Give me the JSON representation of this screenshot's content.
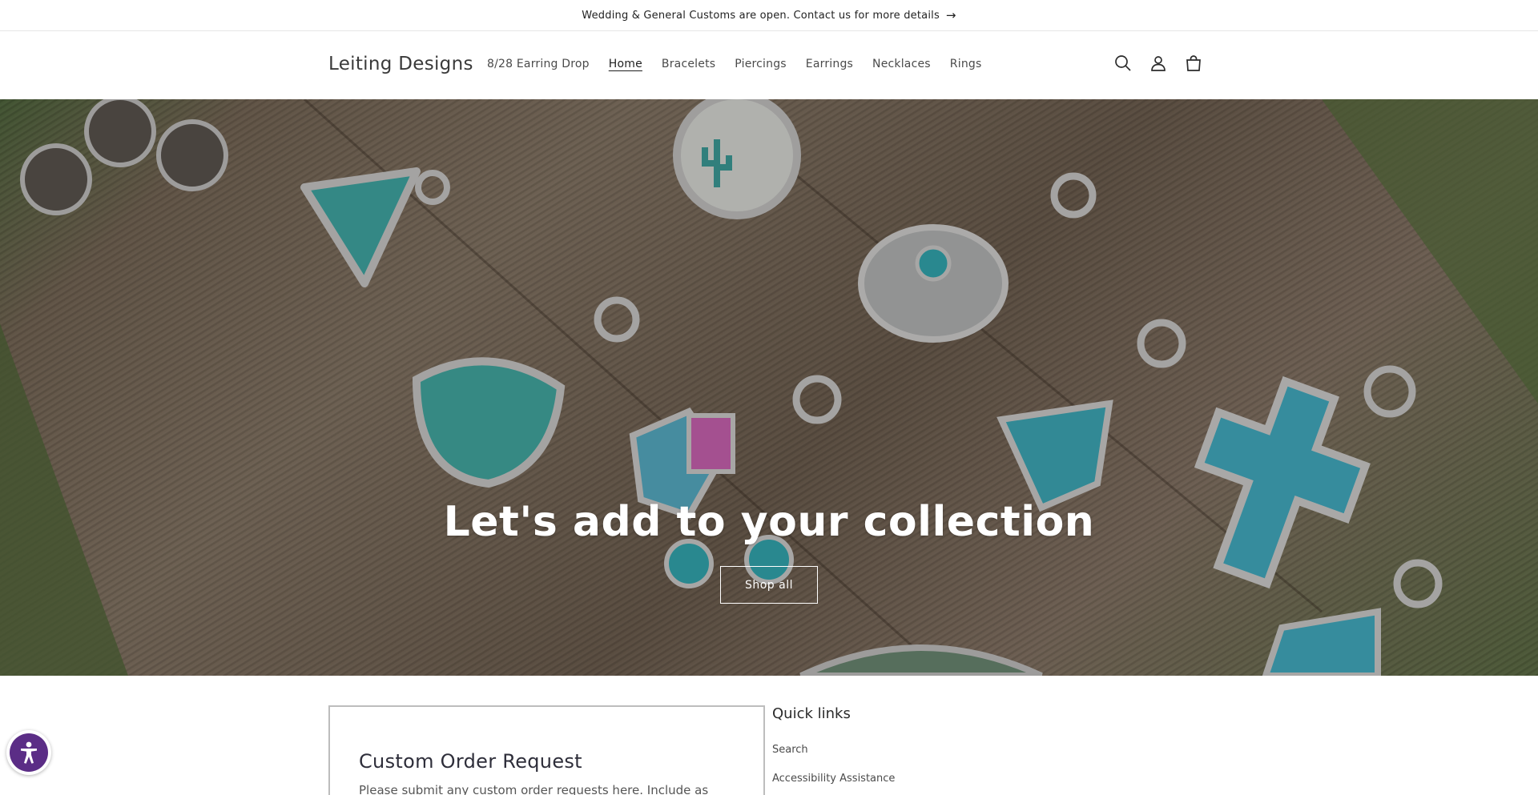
{
  "announcement": {
    "text": "Wedding & General Customs are open. Contact us for more details",
    "arrow": "→"
  },
  "header": {
    "logo": "Leiting Designs",
    "nav": [
      {
        "label": "8/28 Earring Drop",
        "active": false
      },
      {
        "label": "Home",
        "active": true
      },
      {
        "label": "Bracelets",
        "active": false
      },
      {
        "label": "Piercings",
        "active": false
      },
      {
        "label": "Earrings",
        "active": false
      },
      {
        "label": "Necklaces",
        "active": false
      },
      {
        "label": "Rings",
        "active": false
      }
    ],
    "icons": [
      "search-icon",
      "account-icon",
      "cart-icon"
    ]
  },
  "hero": {
    "title": "Let's add to your collection",
    "button": "Shop all"
  },
  "custom_order": {
    "title": "Custom Order Request",
    "text": "Please submit any custom order requests here. Include as"
  },
  "quick_links": {
    "title": "Quick links",
    "links": [
      "Search",
      "Accessibility Assistance"
    ]
  },
  "accessibility_widget": {
    "icon": "accessibility-icon"
  },
  "colors": {
    "accent": "#5b2d86",
    "turquoise": "#3fb8c2",
    "text": "#2b2b2b"
  }
}
